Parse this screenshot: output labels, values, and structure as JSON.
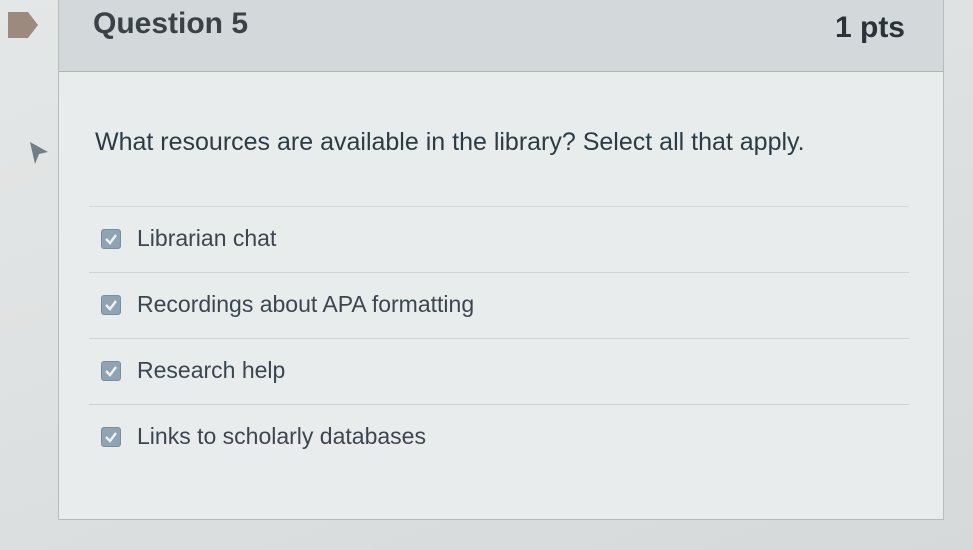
{
  "question": {
    "title": "Question 5",
    "points": "1 pts",
    "text": "What resources are available in the library? Select all that apply.",
    "flag_icon": "flag-icon",
    "answers": [
      {
        "label": "Librarian chat",
        "checked": true
      },
      {
        "label": "Recordings about APA formatting",
        "checked": true
      },
      {
        "label": "Research help",
        "checked": true
      },
      {
        "label": "Links to scholarly databases",
        "checked": true
      }
    ]
  },
  "colors": {
    "flag": "#9c8a7e",
    "checkbox": "#8fa3b2",
    "header_bg": "#d3d8da"
  }
}
